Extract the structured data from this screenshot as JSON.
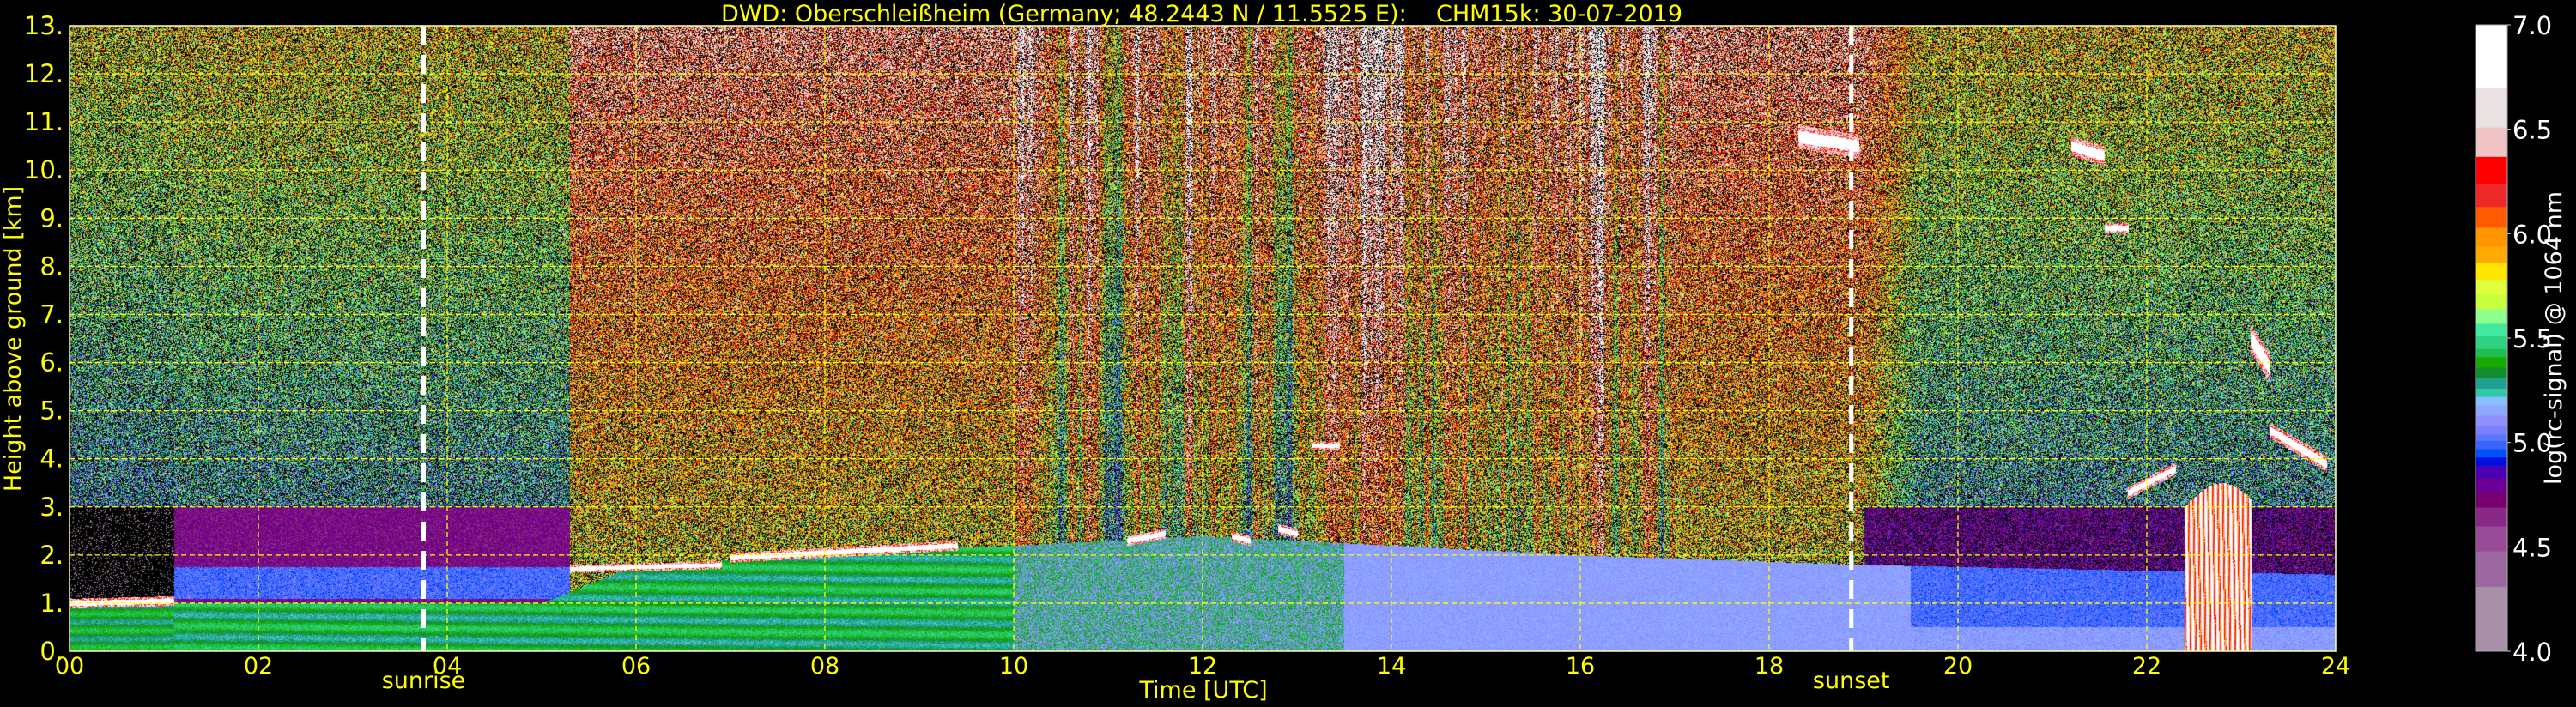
{
  "chart_data": {
    "type": "heatmap",
    "title": "DWD: Oberschleißheim (Germany; 48.2443 N / 11.5525 E):    CHM15k: 30-07-2019",
    "xlabel": "Time [UTC]",
    "ylabel": "Height above ground [km]",
    "xlim": [
      0,
      24
    ],
    "ylim": [
      0,
      13
    ],
    "x_ticks": [
      0,
      2,
      4,
      6,
      8,
      10,
      12,
      14,
      16,
      18,
      20,
      22,
      24
    ],
    "x_tick_labels": [
      "00",
      "02",
      "04",
      "06",
      "08",
      "10",
      "12",
      "14",
      "16",
      "18",
      "20",
      "22",
      "24"
    ],
    "y_ticks": [
      0,
      1,
      2,
      3,
      4,
      5,
      6,
      7,
      8,
      9,
      10,
      11,
      12,
      13
    ],
    "y_tick_labels": [
      "0.",
      "1.",
      "2.",
      "3.",
      "4.",
      "5.",
      "6.",
      "7.",
      "8.",
      "9.",
      "10.",
      "11.",
      "12.",
      "13."
    ],
    "grid": true,
    "grid_color": "#ffff00",
    "text_color": "#ffff00",
    "annotations": [
      {
        "label": "sunrise",
        "time": 3.75
      },
      {
        "label": "sunset",
        "time": 18.87
      }
    ],
    "colorbar": {
      "label": "log(rc-signal) @ 1064 nm",
      "range": [
        4.0,
        7.0
      ],
      "ticks": [
        4.0,
        4.5,
        5.0,
        5.5,
        6.0,
        6.5,
        7.0
      ],
      "tick_labels": [
        "4.0",
        "4.5",
        "5.0",
        "5.5",
        "6.0",
        "6.5",
        "7.0"
      ],
      "bins": [
        {
          "from": 4.0,
          "color": "#a890a8"
        },
        {
          "from": 4.31,
          "color": "#9c6aa0"
        },
        {
          "from": 4.48,
          "color": "#984c98"
        },
        {
          "from": 4.6,
          "color": "#8a2888"
        },
        {
          "from": 4.69,
          "color": "#780070"
        },
        {
          "from": 4.76,
          "color": "#6a0096"
        },
        {
          "from": 4.83,
          "color": "#4c00b4"
        },
        {
          "from": 4.89,
          "color": "#0010e0"
        },
        {
          "from": 4.93,
          "color": "#0050ff"
        },
        {
          "from": 4.97,
          "color": "#3c64ff"
        },
        {
          "from": 5.01,
          "color": "#5a78ff"
        },
        {
          "from": 5.04,
          "color": "#7a80ff"
        },
        {
          "from": 5.08,
          "color": "#9090ff"
        },
        {
          "from": 5.13,
          "color": "#8ca8ff"
        },
        {
          "from": 5.18,
          "color": "#88bfff"
        },
        {
          "from": 5.22,
          "color": "#30c8a8"
        },
        {
          "from": 5.26,
          "color": "#20a090"
        },
        {
          "from": 5.31,
          "color": "#148c30"
        },
        {
          "from": 5.36,
          "color": "#18aa00"
        },
        {
          "from": 5.41,
          "color": "#20be50"
        },
        {
          "from": 5.45,
          "color": "#2ed280"
        },
        {
          "from": 5.51,
          "color": "#40e8a0"
        },
        {
          "from": 5.57,
          "color": "#8cff8c"
        },
        {
          "from": 5.64,
          "color": "#c8ff3c"
        },
        {
          "from": 5.71,
          "color": "#e0ff3c"
        },
        {
          "from": 5.78,
          "color": "#ffe600"
        },
        {
          "from": 5.86,
          "color": "#ffaa00"
        },
        {
          "from": 5.94,
          "color": "#ff9600"
        },
        {
          "from": 6.03,
          "color": "#ff5a00"
        },
        {
          "from": 6.13,
          "color": "#ee2828"
        },
        {
          "from": 6.24,
          "color": "#ff0000"
        },
        {
          "from": 6.37,
          "color": "#f0c4c4"
        },
        {
          "from": 6.51,
          "color": "#ebe3e3"
        },
        {
          "from": 6.7,
          "color": "#ffffff"
        }
      ]
    },
    "features": {
      "cloud_layers": [
        {
          "t": [
            0.0,
            1.1
          ],
          "h": [
            1.0,
            1.05
          ],
          "thick": 0.05
        },
        {
          "t": [
            5.3,
            6.9
          ],
          "h": [
            1.72,
            1.8
          ],
          "thick": 0.04
        },
        {
          "t": [
            7.0,
            9.4
          ],
          "h": [
            1.95,
            2.2
          ],
          "thick": 0.05
        },
        {
          "t": [
            11.2,
            11.6
          ],
          "h": [
            2.3,
            2.45
          ],
          "thick": 0.05
        },
        {
          "t": [
            12.3,
            12.5
          ],
          "h": [
            2.4,
            2.3
          ],
          "thick": 0.05
        },
        {
          "t": [
            12.8,
            13.0
          ],
          "h": [
            2.55,
            2.45
          ],
          "thick": 0.05
        },
        {
          "t": [
            13.15,
            13.45
          ],
          "h": [
            4.28,
            4.28
          ],
          "thick": 0.04
        },
        {
          "t": [
            18.3,
            18.95
          ],
          "h": [
            10.7,
            10.5
          ],
          "thick": 0.12
        },
        {
          "t": [
            21.2,
            21.55
          ],
          "h": [
            10.5,
            10.3
          ],
          "thick": 0.1
        },
        {
          "t": [
            21.55,
            21.8
          ],
          "h": [
            8.8,
            8.8
          ],
          "thick": 0.05
        },
        {
          "t": [
            23.1,
            23.3
          ],
          "h": [
            6.5,
            5.9
          ],
          "thick": 0.15
        },
        {
          "t": [
            21.8,
            22.3
          ],
          "h": [
            3.3,
            3.8
          ],
          "thick": 0.06
        },
        {
          "t": [
            23.3,
            23.9
          ],
          "h": [
            4.6,
            3.9
          ],
          "thick": 0.08
        }
      ],
      "rain": {
        "t": [
          22.4,
          23.1
        ],
        "top_km": 3.0
      },
      "boundary_layer_top_km": {
        "t": [
          0,
          5,
          6,
          9,
          12,
          16,
          19,
          24
        ],
        "h": [
          1.0,
          1.0,
          1.8,
          2.1,
          2.4,
          2.0,
          1.8,
          1.6
        ]
      }
    }
  }
}
